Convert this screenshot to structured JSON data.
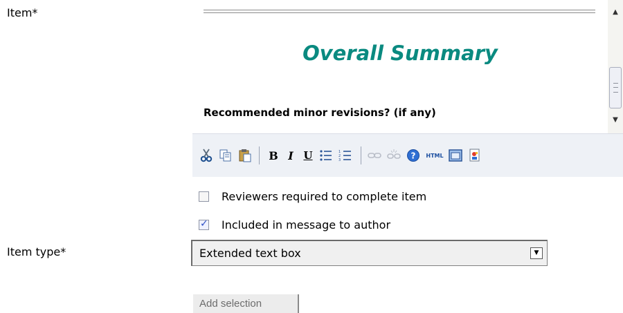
{
  "form": {
    "item_label": "Item*",
    "item_type_label": "Item type*"
  },
  "editor": {
    "title": "Overall Summary",
    "question": "Recommended minor revisions? (if any)",
    "toolbar": {
      "cut": "cut-icon",
      "copy": "copy-icon",
      "paste": "paste-icon",
      "bold": "B",
      "italic": "I",
      "underline": "U",
      "bullet_list": "bullet-list-icon",
      "numbered_list": "numbered-list-icon",
      "link": "link-icon",
      "unlink": "unlink-icon",
      "help": "help-icon",
      "html": "HTML",
      "table": "table-icon",
      "image": "image-icon"
    }
  },
  "options": {
    "reviewers_required": {
      "label": "Reviewers required to complete item",
      "checked": false
    },
    "included_in_message": {
      "label": "Included in message to author",
      "checked": true
    }
  },
  "item_type": {
    "selected": "Extended text box"
  },
  "actions": {
    "add_selection": "Add selection"
  },
  "colors": {
    "title": "#0a8a80",
    "toolbar_bg": "#eef1f6"
  }
}
